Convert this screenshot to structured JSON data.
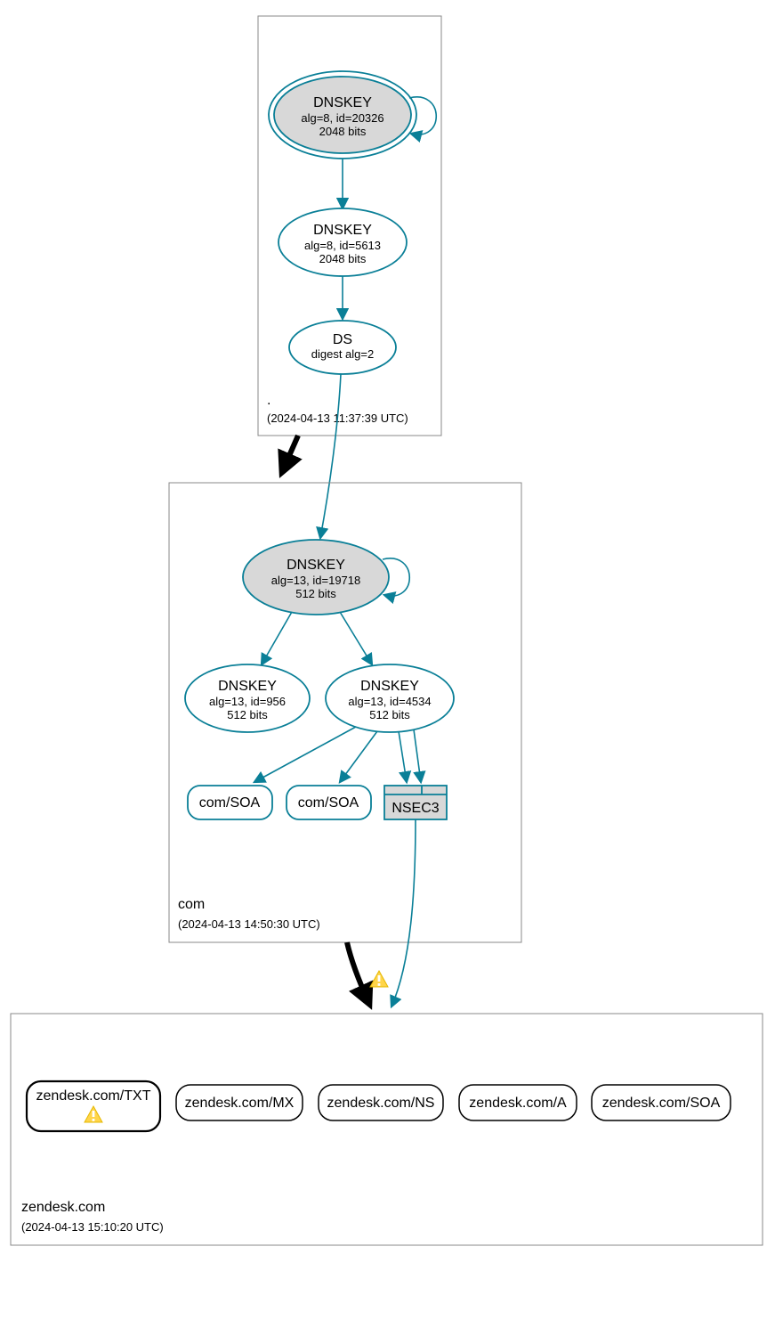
{
  "zones": {
    "root": {
      "label": ".",
      "timestamp": "(2024-04-13 11:37:39 UTC)"
    },
    "com": {
      "label": "com",
      "timestamp": "(2024-04-13 14:50:30 UTC)"
    },
    "zendesk": {
      "label": "zendesk.com",
      "timestamp": "(2024-04-13 15:10:20 UTC)"
    }
  },
  "nodes": {
    "root_ksk": {
      "title": "DNSKEY",
      "line2": "alg=8, id=20326",
      "line3": "2048 bits"
    },
    "root_zsk": {
      "title": "DNSKEY",
      "line2": "alg=8, id=5613",
      "line3": "2048 bits"
    },
    "root_ds": {
      "title": "DS",
      "line2": "digest alg=2"
    },
    "com_ksk": {
      "title": "DNSKEY",
      "line2": "alg=13, id=19718",
      "line3": "512 bits"
    },
    "com_zsk1": {
      "title": "DNSKEY",
      "line2": "alg=13, id=956",
      "line3": "512 bits"
    },
    "com_zsk2": {
      "title": "DNSKEY",
      "line2": "alg=13, id=4534",
      "line3": "512 bits"
    },
    "com_soa1": {
      "title": "com/SOA"
    },
    "com_soa2": {
      "title": "com/SOA"
    },
    "nsec3": {
      "title": "NSEC3"
    },
    "zendesk_txt": {
      "title": "zendesk.com/TXT"
    },
    "zendesk_mx": {
      "title": "zendesk.com/MX"
    },
    "zendesk_ns": {
      "title": "zendesk.com/NS"
    },
    "zendesk_a": {
      "title": "zendesk.com/A"
    },
    "zendesk_soa": {
      "title": "zendesk.com/SOA"
    }
  },
  "colors": {
    "teal": "#0a7f97",
    "grayFill": "#d8d8d8",
    "warnFill": "#ffd54a",
    "warnStroke": "#e6b800"
  }
}
